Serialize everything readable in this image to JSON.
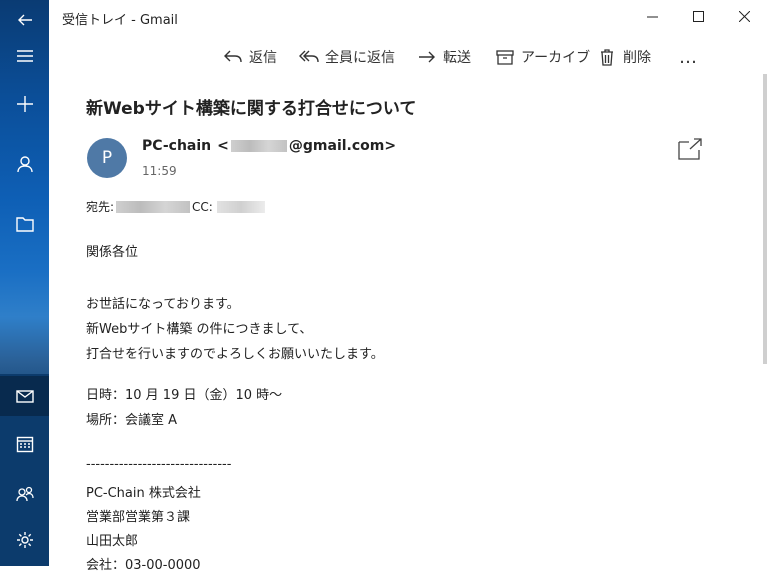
{
  "window": {
    "title": "受信トレイ - Gmail",
    "controls": [
      "minimize-icon",
      "maximize-icon",
      "close-icon"
    ]
  },
  "rail": {
    "items": [
      {
        "name": "back",
        "icon": "back-arrow-icon"
      },
      {
        "name": "menu",
        "icon": "hamburger-icon"
      },
      {
        "name": "new-mail",
        "icon": "plus-icon"
      },
      {
        "name": "accounts",
        "icon": "person-icon"
      },
      {
        "name": "folders",
        "icon": "folder-icon"
      },
      {
        "name": "mail",
        "icon": "mail-icon"
      },
      {
        "name": "calendar",
        "icon": "calendar-icon"
      },
      {
        "name": "people",
        "icon": "people-icon"
      },
      {
        "name": "settings",
        "icon": "gear-icon"
      }
    ]
  },
  "toolbar": {
    "reply": "返信",
    "reply_all": "全員に返信",
    "forward": "転送",
    "archive": "アーカイブ",
    "delete": "削除",
    "more": "…"
  },
  "message": {
    "subject": "新Webサイト構築に関する打合せについて",
    "avatar_initial": "P",
    "sender_name": "PC-chain",
    "sender_open": "<",
    "sender_domain": "@gmail.com>",
    "time": "11:59",
    "to_label": "宛先:",
    "cc_label": "CC:",
    "body": {
      "greeting": "関係各位",
      "line1": "お世話になっております。",
      "line2": "新Webサイト構築 の件につきまして、",
      "line3": "打合せを行いますのでよろしくお願いいたします。",
      "date_line": "日時：10 月 19 日（金）10 時～",
      "place_line": "場所：会議室 A",
      "separator": "-------------------------------",
      "company": "PC-Chain 株式会社",
      "department": "営業部営業第３課",
      "signer": "山田太郎",
      "phone_partial": "会社：03-00-0000"
    }
  },
  "colors": {
    "avatar": "#4f79a6",
    "rail_active": "#0c3b6c"
  }
}
